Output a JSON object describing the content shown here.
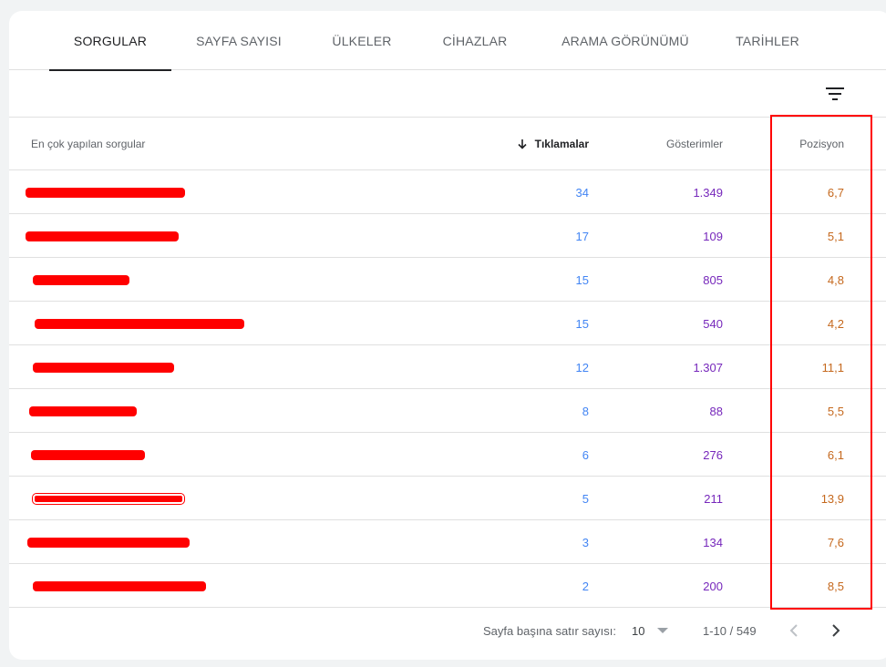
{
  "tabs": [
    {
      "label": "SORGULAR",
      "active": true
    },
    {
      "label": "SAYFA SAYISI",
      "active": false
    },
    {
      "label": "ÜLKELER",
      "active": false
    },
    {
      "label": "CİHAZLAR",
      "active": false
    },
    {
      "label": "ARAMA GÖRÜNÜMÜ",
      "active": false
    },
    {
      "label": "TARİHLER",
      "active": false
    }
  ],
  "toolbar": {
    "filter_icon": "filter-icon"
  },
  "table": {
    "headers": {
      "query": "En çok yapılan sorgular",
      "clicks": "Tıklamalar",
      "impressions": "Gösterimler",
      "position": "Pozisyon"
    },
    "sort": {
      "column": "clicks",
      "direction": "desc",
      "icon": "arrow-down-icon"
    },
    "rows": [
      {
        "query": "",
        "clicks": "34",
        "impressions": "1.349",
        "position": "6,7"
      },
      {
        "query": "",
        "clicks": "17",
        "impressions": "109",
        "position": "5,1"
      },
      {
        "query": "",
        "clicks": "15",
        "impressions": "805",
        "position": "4,8"
      },
      {
        "query": "",
        "clicks": "15",
        "impressions": "540",
        "position": "4,2"
      },
      {
        "query": "",
        "clicks": "12",
        "impressions": "1.307",
        "position": "11,1"
      },
      {
        "query": "",
        "clicks": "8",
        "impressions": "88",
        "position": "5,5"
      },
      {
        "query": "",
        "clicks": "6",
        "impressions": "276",
        "position": "6,1"
      },
      {
        "query": "",
        "clicks": "5",
        "impressions": "211",
        "position": "13,9"
      },
      {
        "query": "",
        "clicks": "3",
        "impressions": "134",
        "position": "7,6"
      },
      {
        "query": "",
        "clicks": "2",
        "impressions": "200",
        "position": "8,5"
      }
    ]
  },
  "pagination": {
    "rows_per_page_label": "Sayfa başına satır sayısı:",
    "rows_per_page_value": "10",
    "range": "1-10 / 549"
  },
  "colors": {
    "clicks": "#4285f4",
    "impressions": "#7627bb",
    "position": "#c5681d",
    "highlight": "#ff0000"
  }
}
